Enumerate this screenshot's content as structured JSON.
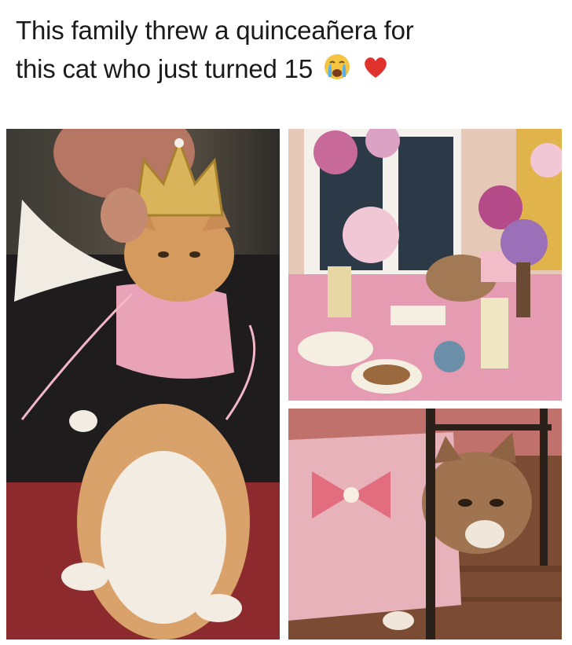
{
  "caption": {
    "line1": "This family threw a quinceañera for",
    "line2": "this cat who just turned 15",
    "emojis": [
      "crying-face-emoji",
      "red-heart-emoji"
    ]
  },
  "photos": [
    {
      "name": "cat-crowned-held-photo",
      "subject": "orange-white cat in pink dress wearing gold crown held by woman"
    },
    {
      "name": "party-table-photo",
      "subject": "pink party table with balloons, candles and food; cat in pink dress in background"
    },
    {
      "name": "cat-under-table-photo",
      "subject": "cat in pink dress with bow under table"
    }
  ],
  "colors": {
    "text": "#1a1a1a",
    "background": "#ffffff",
    "pink": "#e9a3b8",
    "cat_orange": "#d9a36a"
  }
}
